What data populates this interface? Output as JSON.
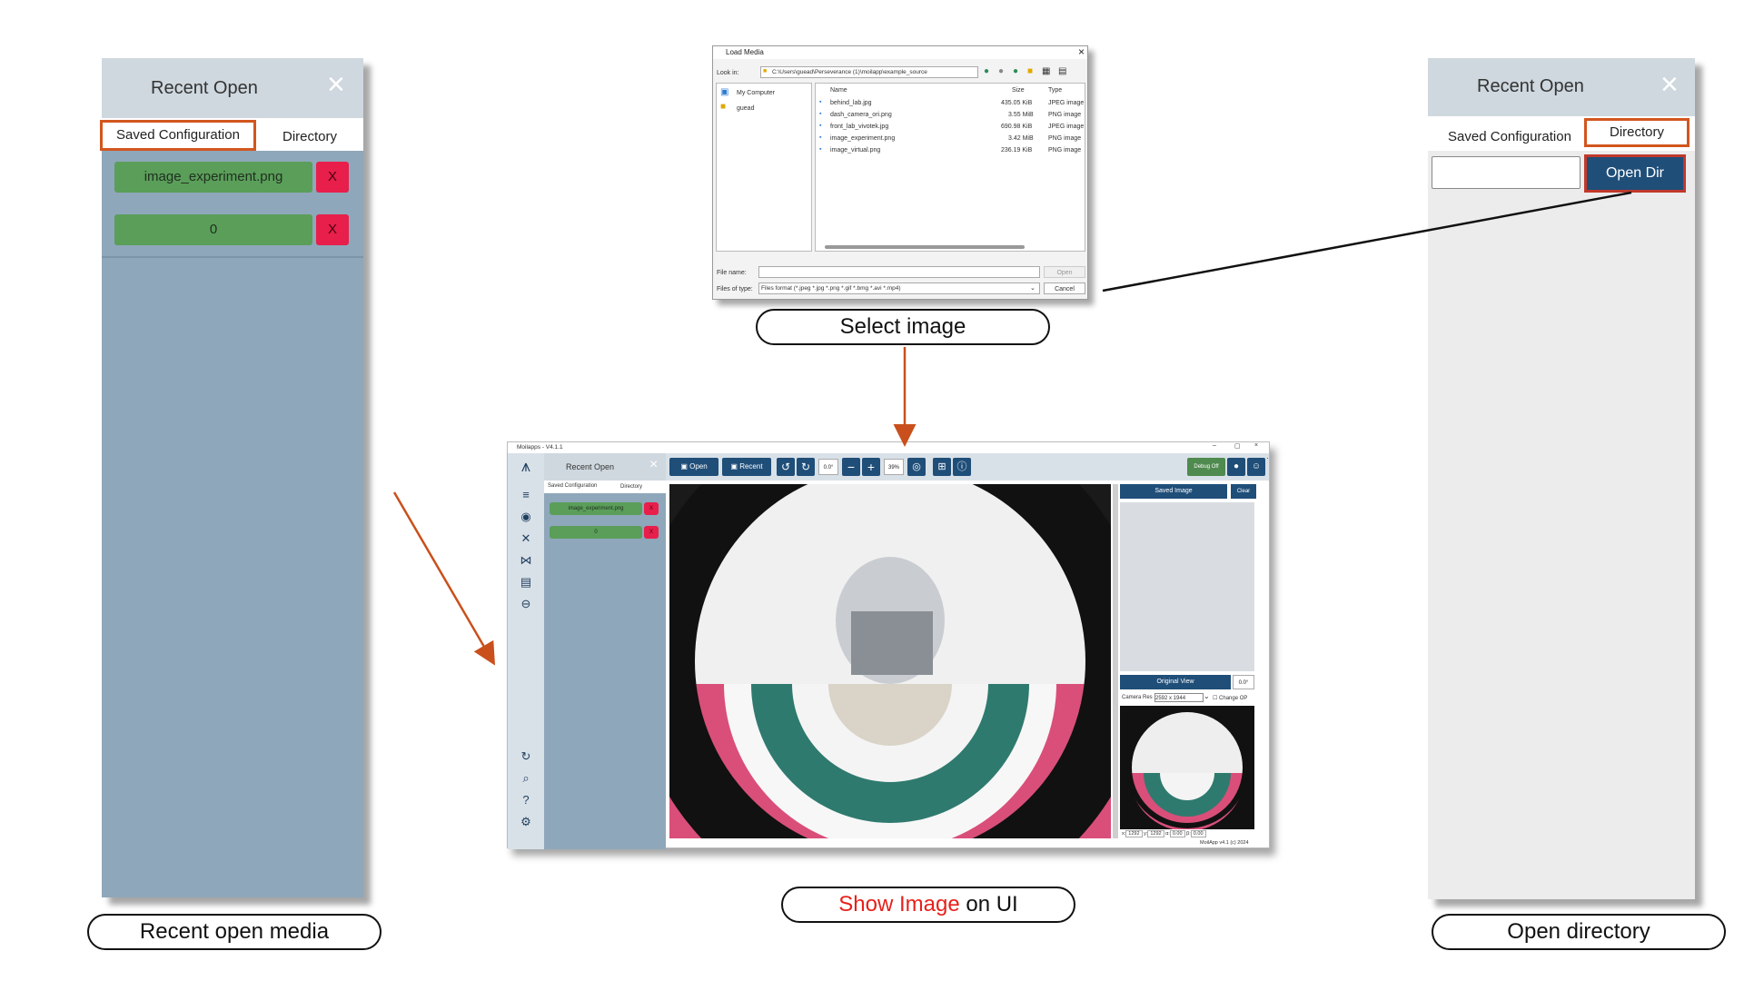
{
  "left_panel": {
    "title": "Recent Open",
    "close_glyph": "×",
    "tabs": [
      "Saved Configuration",
      "Directory"
    ],
    "items": [
      {
        "label": "image_experiment.png",
        "delete": "X"
      },
      {
        "label": "0",
        "delete": "X"
      }
    ],
    "caption": "Recent open media"
  },
  "right_panel": {
    "title": "Recent Open",
    "close_glyph": "×",
    "tabs": [
      "Saved Configuration",
      "Directory"
    ],
    "input_value": "",
    "open_dir_label": "Open Dir",
    "caption": "Open directory"
  },
  "dialog": {
    "title": "Load Media",
    "close_glyph": "×",
    "look_in_label": "Look in:",
    "path": "C:\\Users\\guead\\Perseverance (1)\\moilapp\\example_source",
    "places": [
      "My Computer",
      "guead"
    ],
    "columns": [
      "Name",
      "Size",
      "Type"
    ],
    "files": [
      {
        "name": "behind_lab.jpg",
        "size": "435.05 KiB",
        "type": "JPEG image"
      },
      {
        "name": "dash_camera_ori.png",
        "size": "3.55 MiB",
        "type": "PNG image"
      },
      {
        "name": "front_lab_vivotek.jpg",
        "size": "690.98 KiB",
        "type": "JPEG image"
      },
      {
        "name": "image_experiment.png",
        "size": "3.42 MiB",
        "type": "PNG image"
      },
      {
        "name": "image_virtual.png",
        "size": "236.19 KiB",
        "type": "PNG image"
      }
    ],
    "file_name_label": "File name:",
    "file_name_value": "",
    "open_label": "Open",
    "files_of_type_label": "Files of type:",
    "files_of_type_value": "Files format (*.jpeg *.jpg *.png *.gif *.bmg *.avi *.mp4)",
    "cancel_label": "Cancel",
    "caption": "Select image"
  },
  "app": {
    "window_title": "Moilapps - V4.1.1",
    "panel_title": "Recent Open",
    "panel_tabs": [
      "Saved Configuration",
      "Directory"
    ],
    "panel_items": [
      {
        "label": "image_experiment.png",
        "delete": "X"
      },
      {
        "label": "0",
        "delete": "X"
      }
    ],
    "toolbar": {
      "open_label": "Open",
      "recent_label": "Recent",
      "rotation_value": "0.0°",
      "zoom_value": "39%",
      "debug_label": "Debug Off"
    },
    "saved_image_label": "Saved Image",
    "clear_label": "Clear",
    "original_view_label": "Original View",
    "original_view_angle": "0.0°",
    "camera_res_label": "Camera Res :",
    "camera_res_value": "2592 x 1944",
    "change_op_label": "Change OP",
    "coords": {
      "x_label": "x:",
      "x_value": "1292",
      "y_label": "y:",
      "y_value": "1292",
      "alpha_label": "α:",
      "alpha_value": "0.00",
      "beta_label": "β:",
      "beta_value": "0.00"
    },
    "footer": "MoilApp v4.1 (c) 2024",
    "caption_highlight": "Show Image",
    "caption_rest": " on UI"
  },
  "colors": {
    "panel_blue": "#8fa7ba",
    "highlight_orange": "#d2561e",
    "arrow_orange": "#c9501c",
    "button_green": "#5a9e5a",
    "button_red": "#e81e4b",
    "dark_blue": "#1f4e79",
    "caption_red": "#e8201a"
  }
}
